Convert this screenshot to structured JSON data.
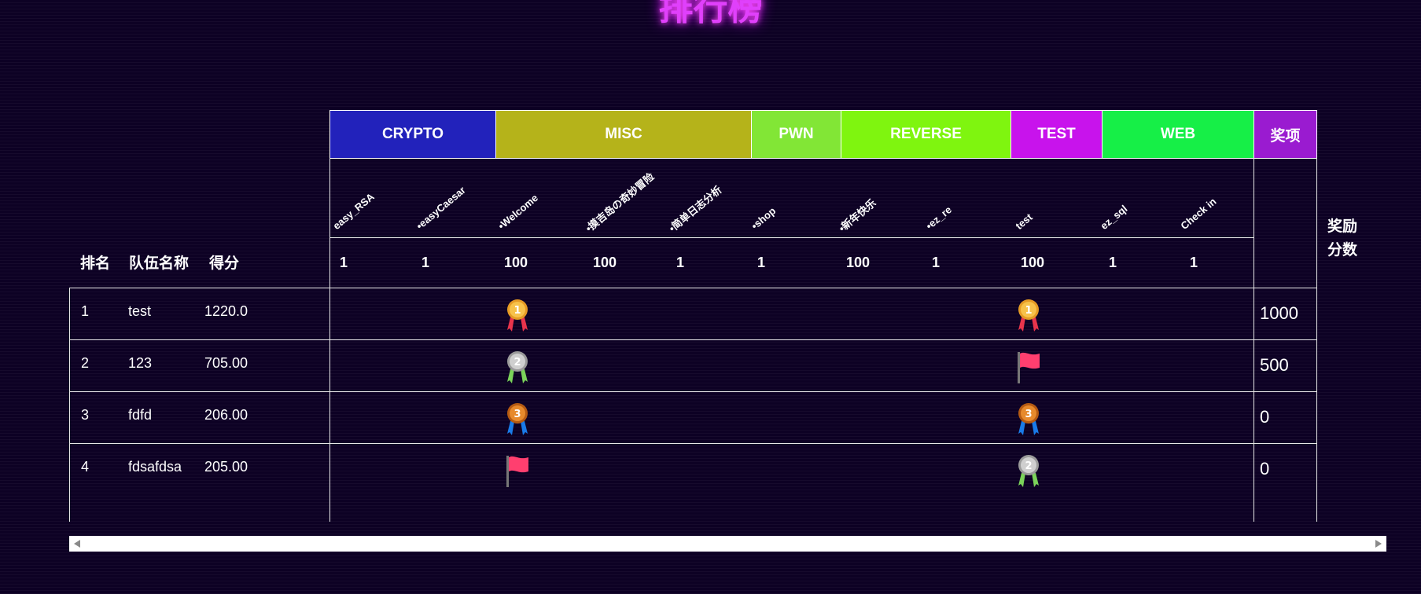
{
  "page_title": "排行榜",
  "categories": [
    {
      "name": "CRYPTO",
      "color": "#2222bb"
    },
    {
      "name": "MISC",
      "color": "#b5b31a"
    },
    {
      "name": "PWN",
      "color": "#82e636"
    },
    {
      "name": "REVERSE",
      "color": "#7ff50f"
    },
    {
      "name": "TEST",
      "color": "#c813ec"
    },
    {
      "name": "WEB",
      "color": "#16ef47"
    },
    {
      "name": "奖项",
      "color": "#9a1bd0"
    }
  ],
  "challenges": [
    {
      "name": "easy_RSA",
      "points": "1"
    },
    {
      "name": "•easyCaesar",
      "points": "1"
    },
    {
      "name": "•Welcome",
      "points": "100"
    },
    {
      "name": "•摸吉岛の奇妙冒险",
      "points": "100"
    },
    {
      "name": "•简单日志分析",
      "points": "1"
    },
    {
      "name": "•shop",
      "points": "1"
    },
    {
      "name": "•新年快乐",
      "points": "100"
    },
    {
      "name": "•ez_re",
      "points": "1"
    },
    {
      "name": "test",
      "points": "100"
    },
    {
      "name": "ez_sql",
      "points": "1"
    },
    {
      "name": "Check in",
      "points": "1"
    }
  ],
  "headers": {
    "rank": "排名",
    "team": "队伍名称",
    "score": "得分",
    "award_line1": "奖励",
    "award_line2": "分数"
  },
  "rows": [
    {
      "rank": "1",
      "team": "test",
      "score": "1220.0",
      "award": "1000",
      "welcome": "medal-1",
      "test": "medal-1"
    },
    {
      "rank": "2",
      "team": "123",
      "score": "705.00",
      "award": "500",
      "welcome": "medal-2",
      "test": "flag"
    },
    {
      "rank": "3",
      "team": "fdfd",
      "score": "206.00",
      "award": "0",
      "welcome": "medal-3",
      "test": "medal-3"
    },
    {
      "rank": "4",
      "team": "fdsafdsa",
      "score": "205.00",
      "award": "0",
      "welcome": "flag",
      "test": "medal-2"
    }
  ]
}
